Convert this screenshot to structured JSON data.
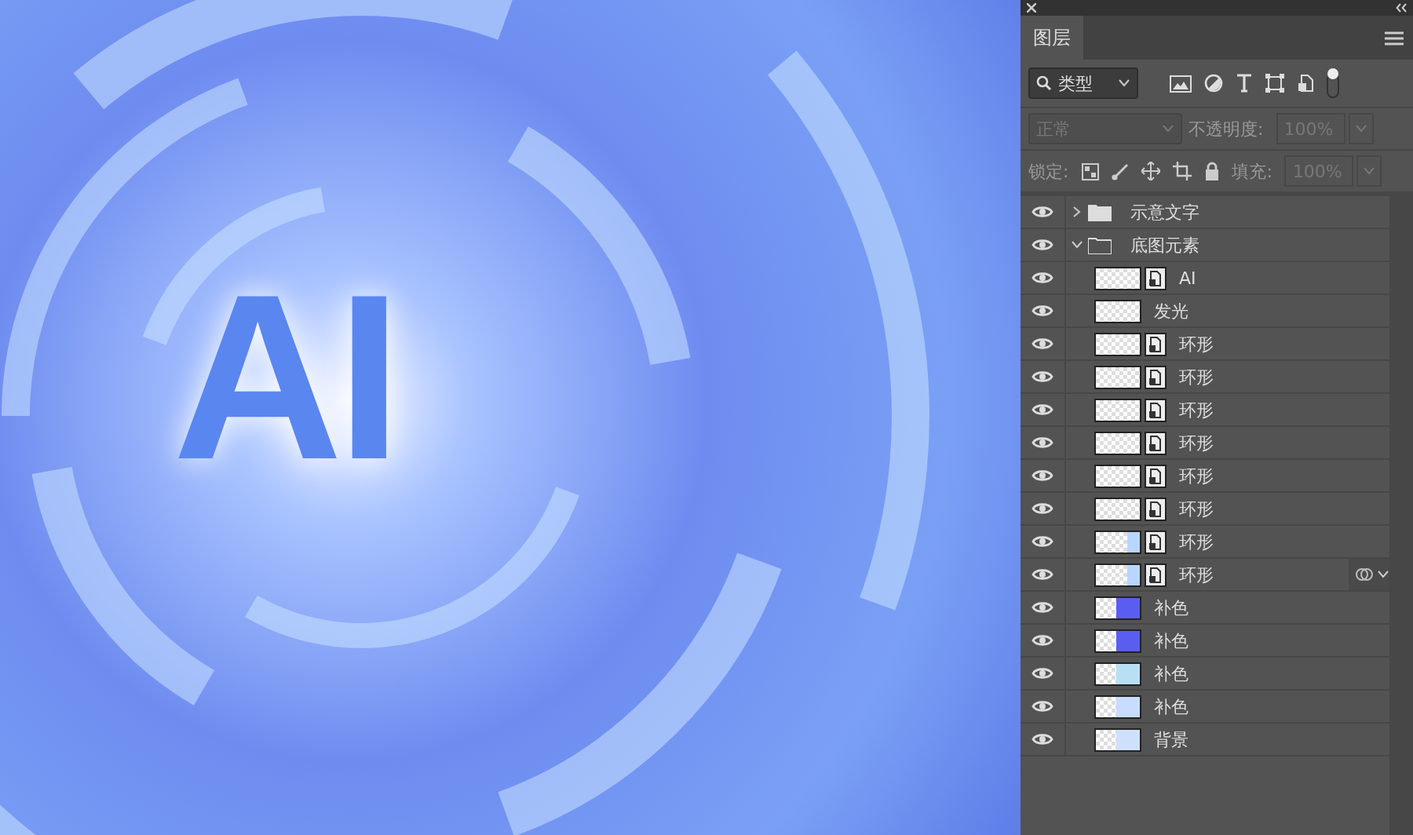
{
  "canvas": {
    "artwork_text": "AI"
  },
  "panel": {
    "tabs": [
      {
        "label": "图层",
        "selected": true
      }
    ],
    "filter": {
      "value": "类型"
    },
    "blend": {
      "value": "正常",
      "disabled": true,
      "opacity_label": "不透明度:",
      "opacity": "100%"
    },
    "lock": {
      "label": "锁定:",
      "fill_label": "填充:",
      "fill": "100%"
    },
    "layers": [
      {
        "kind": "folder",
        "name": "示意文字",
        "visible": true,
        "expanded": false
      },
      {
        "kind": "folder",
        "name": "底图元素",
        "visible": true,
        "expanded": true,
        "children": [
          {
            "kind": "smart",
            "name": "AI",
            "visible": true
          },
          {
            "kind": "pixel",
            "name": "发光",
            "visible": true
          },
          {
            "kind": "smart",
            "name": "环形",
            "visible": true
          },
          {
            "kind": "smart",
            "name": "环形",
            "visible": true
          },
          {
            "kind": "smart",
            "name": "环形",
            "visible": true
          },
          {
            "kind": "smart",
            "name": "环形",
            "visible": true
          },
          {
            "kind": "smart",
            "name": "环形",
            "visible": true
          },
          {
            "kind": "smart",
            "name": "环形",
            "visible": true
          },
          {
            "kind": "smart",
            "name": "环形",
            "visible": true,
            "color": "#b8d6ff"
          },
          {
            "kind": "smart",
            "name": "环形",
            "visible": true,
            "color": "#b8d6ff",
            "blend_options": true
          },
          {
            "kind": "pixel",
            "name": "补色",
            "visible": true,
            "color": "#5a5ef0"
          },
          {
            "kind": "pixel",
            "name": "补色",
            "visible": true,
            "color": "#5a5ef0"
          },
          {
            "kind": "pixel",
            "name": "补色",
            "visible": true,
            "color": "#b8e0f5"
          },
          {
            "kind": "pixel",
            "name": "补色",
            "visible": true,
            "color": "#c8dcff"
          }
        ]
      },
      {
        "kind": "pixel",
        "name": "背景",
        "visible": true,
        "color": "#cfe0ff"
      }
    ]
  }
}
